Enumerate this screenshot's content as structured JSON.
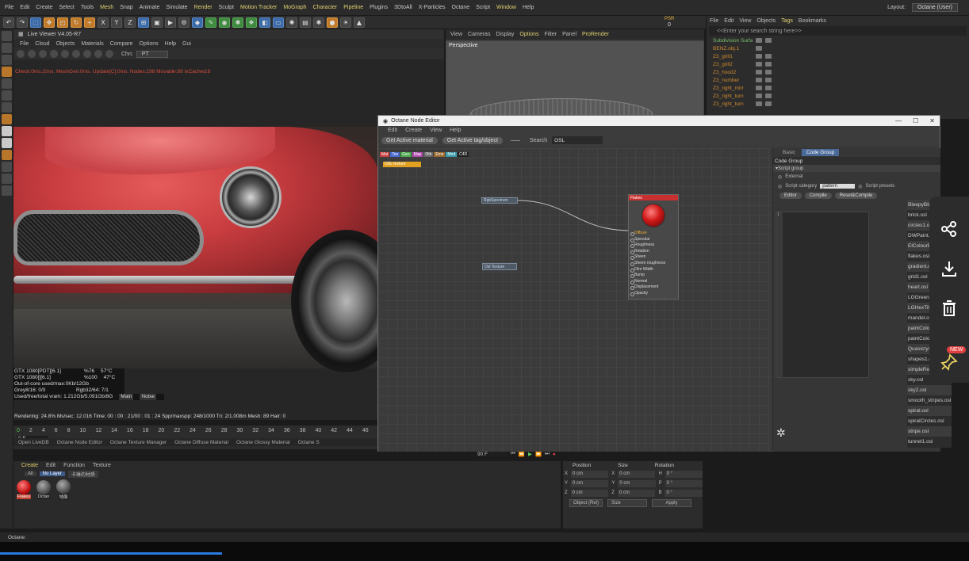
{
  "menubar": {
    "items": [
      "File",
      "Edit",
      "Create",
      "Select",
      "Tools",
      "Mesh",
      "Snap",
      "Animate",
      "Simulate",
      "Render",
      "Sculpt",
      "Motion Tracker",
      "MoGraph",
      "Character",
      "Pipeline",
      "Plugins",
      "3DtoAll",
      "X-Particles",
      "Octane",
      "Script",
      "Window",
      "Help"
    ],
    "layout_label": "Layout:",
    "layout_value": "Octane (User)"
  },
  "toolbar": {
    "axis": [
      "X",
      "Y",
      "Z"
    ],
    "psr_label": "PSR",
    "psr_value": "0",
    "search_placeholder": "<<Enter your search string here>>"
  },
  "live_viewer": {
    "title": "Live Viewer V4.05-R7",
    "menu": [
      "File",
      "Cloud",
      "Objects",
      "Materials",
      "Compare",
      "Options",
      "Help",
      "Gui"
    ],
    "chn_label": "Chn:",
    "chn_value": "PT",
    "status": "Check:0ms./2ms. MeshGen:0ms. Update[C]:0ms. Nodes:198 Movable:89 txCached:8",
    "gpu": [
      {
        "name": "GTX 1080[PDT][6.1]",
        "pct": "%76",
        "temp": "57°C"
      },
      {
        "name": "GTX 1080[][6.1]",
        "pct": "%100",
        "temp": "47°C"
      }
    ],
    "ooc": "Out-of-core used/max:0Kb/12Gb",
    "grey": "Grey8/16: 0/0",
    "rgb": "Rgb32/64: 7/1",
    "vram": "Used/free/total vram: 1.212Gb/5.091Gb/8G",
    "tab_main": "Main",
    "tab_noise": "Noise",
    "rendering": "Rendering: 24.8%  Ms/sec: 12.016  Time: 00 : 00 : 21/00 : 01 : 24  Spp/maxspp: 248/1000  Tri: 2/1.008m  Mesh: 89  Hair: 0"
  },
  "viewport": {
    "menu": [
      "View",
      "Cameras",
      "Display",
      "Options",
      "Filter",
      "Panel",
      "ProRender"
    ],
    "label": "Perspective"
  },
  "object_manager": {
    "menu": [
      "File",
      "Edit",
      "View",
      "Objects",
      "Tags",
      "Bookmarks"
    ],
    "search_placeholder": "<<Enter your search string here>>",
    "items": [
      "Subdivision Surfa",
      "BENZ.obj.1",
      "Z3_grill1",
      "Z3_grill2",
      "Z3_hood2",
      "Z3_number",
      "Z3_right_mirr",
      "Z3_right_turn",
      "Z3_right_turn"
    ]
  },
  "node_editor": {
    "title": "Octane Node Editor",
    "menu": [
      "Edit",
      "Create",
      "View",
      "Help"
    ],
    "btn_active_material": "Get Active material",
    "btn_active_tag": "Get Active tag/object",
    "search_label": "Search",
    "search_value": "OSL",
    "tags": [
      "Mat",
      "Tex",
      "Gen",
      "Map",
      "Oth",
      "Ems",
      "Med",
      "C4D"
    ],
    "osl_node": "OSL texture",
    "node_rgb": "RgbSpectrum",
    "node_osl": "Osl Texture",
    "flakes_title": "Flakes",
    "flakes_pins": [
      "Diffuse",
      "Specular",
      "Roughness",
      "Rotation",
      "Sheen",
      "Sheen roughness",
      "Film Width",
      "Bump",
      "Normal",
      "Displacement",
      "Opacity"
    ],
    "tab_basic": "Basic",
    "tab_code": "Code Group",
    "panel_header": "Code Group",
    "script_group": "Script group",
    "external": "External",
    "script_category": "Script category",
    "category_value": "pattern",
    "script_presets": "Script presets",
    "btn_editor": "Editor",
    "btn_compile": "Compile",
    "btn_reset": "Reset&Compile",
    "line_number": "1",
    "presets": [
      "BleepyBlinks.osl",
      "brick.osl",
      "circles1.osl",
      "DWPaint.osl",
      "ElColourBase.osl",
      "flakes.osl",
      "gradient.osl",
      "grid1.osl",
      "heart.osl",
      "LGGreen.osl",
      "LGHexTiles.osl",
      "mandel.osl",
      "paintColors.osl",
      "paintColors2.osl",
      "Quasicrystal.osl",
      "shapes1.osl",
      "simpleRect.osl",
      "sky.osl",
      "sky2.osl",
      "smooth_stripes.osl",
      "spiral.osl",
      "spiralCircles.osl",
      "stripe.osl",
      "tunnel1.osl"
    ]
  },
  "side_panel": {
    "new_badge": "NEW"
  },
  "timeline": {
    "ticks": [
      "0",
      "2",
      "4",
      "6",
      "8",
      "10",
      "12",
      "14",
      "16",
      "18",
      "20",
      "22",
      "24",
      "26",
      "28",
      "30",
      "32",
      "34",
      "36",
      "38",
      "40",
      "42",
      "44",
      "46",
      "48"
    ],
    "frame": "0 F",
    "end_frame": "90 F",
    "tabs": [
      "Open LiveDB",
      "Octane Node Editor",
      "Octane Texture Manager",
      "Octane Diffuse Material",
      "Octane Glossy Material",
      "Octane S"
    ]
  },
  "material_manager": {
    "menu": [
      "Create",
      "Edit",
      "Function",
      "Texture"
    ],
    "tab_all": "All",
    "tab_nolayer": "No Layer",
    "tab_other": "卡琳的材质",
    "materials": [
      "Flakes",
      "Octan",
      "地面"
    ]
  },
  "coordinates": {
    "headers": [
      "Position",
      "Size",
      "Rotation"
    ],
    "rows": [
      {
        "a": "X",
        "av": "0 cm",
        "b": "X",
        "bv": "0 cm",
        "c": "H",
        "cv": "0 °"
      },
      {
        "a": "Y",
        "av": "0 cm",
        "b": "Y",
        "bv": "0 cm",
        "c": "P",
        "cv": "0 °"
      },
      {
        "a": "Z",
        "av": "0 cm",
        "b": "Z",
        "bv": "0 cm",
        "c": "B",
        "cv": "0 °"
      }
    ],
    "mode": "Object (Rel)",
    "size_mode": "Size",
    "apply": "Apply"
  },
  "statusbar": {
    "text": "Octane:"
  }
}
